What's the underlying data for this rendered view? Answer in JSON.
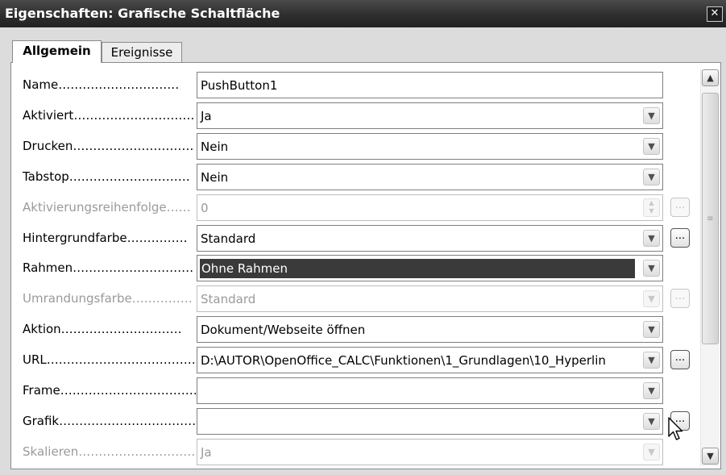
{
  "window": {
    "title": "Eigenschaften: Grafische Schaltfläche",
    "close_glyph": "✕"
  },
  "tabs": [
    {
      "label": "Allgemein",
      "active": true
    },
    {
      "label": "Ereignisse",
      "active": false
    }
  ],
  "rows": [
    {
      "label": "Name…………………………",
      "value": "PushButton1",
      "control": "text",
      "enabled": true
    },
    {
      "label": "Aktiviert…………………………",
      "value": "Ja",
      "control": "dropdown",
      "enabled": true
    },
    {
      "label": "Drucken…………………………",
      "value": "Nein",
      "control": "dropdown",
      "enabled": true
    },
    {
      "label": "Tabstop…………………………",
      "value": "Nein",
      "control": "dropdown",
      "enabled": true
    },
    {
      "label": "Aktivierungsreihenfolge……",
      "value": "0",
      "control": "spin",
      "enabled": false,
      "ellipsis": "..."
    },
    {
      "label": "Hintergrundfarbe……………",
      "value": "Standard",
      "control": "dropdown",
      "enabled": true,
      "ellipsis": "..."
    },
    {
      "label": "Rahmen…………………………",
      "value": "Ohne Rahmen",
      "control": "dropdown",
      "enabled": true,
      "selected": true
    },
    {
      "label": "Umrandungsfarbe……………",
      "value": "Standard",
      "control": "dropdown",
      "enabled": false,
      "ellipsis": "..."
    },
    {
      "label": "Aktion…………………………",
      "value": "Dokument/Webseite öffnen",
      "control": "dropdown",
      "enabled": true
    },
    {
      "label": "URL…………………………………",
      "value": "D:\\AUTOR\\OpenOffice_CALC\\Funktionen\\1_Grundlagen\\10_Hyperlin",
      "control": "dropdown",
      "enabled": true,
      "ellipsis": "..."
    },
    {
      "label": "Frame…………………………………",
      "value": "",
      "control": "dropdown",
      "enabled": true
    },
    {
      "label": "Grafik…………………………………",
      "value": "",
      "control": "dropdown",
      "enabled": true,
      "ellipsis": "..."
    },
    {
      "label": "Skalieren…………………………",
      "value": "Ja",
      "control": "dropdown",
      "enabled": false
    }
  ],
  "icons": {
    "dropdown": "▼",
    "spin_up": "▲",
    "spin_down": "▼",
    "scroll_up": "▲",
    "scroll_down": "▼",
    "thumb_grip": "≡"
  },
  "colors": {
    "titlebar": "#2e2e2e",
    "selection": "#3a3a3a",
    "disabled_text": "#9a9a9a"
  }
}
